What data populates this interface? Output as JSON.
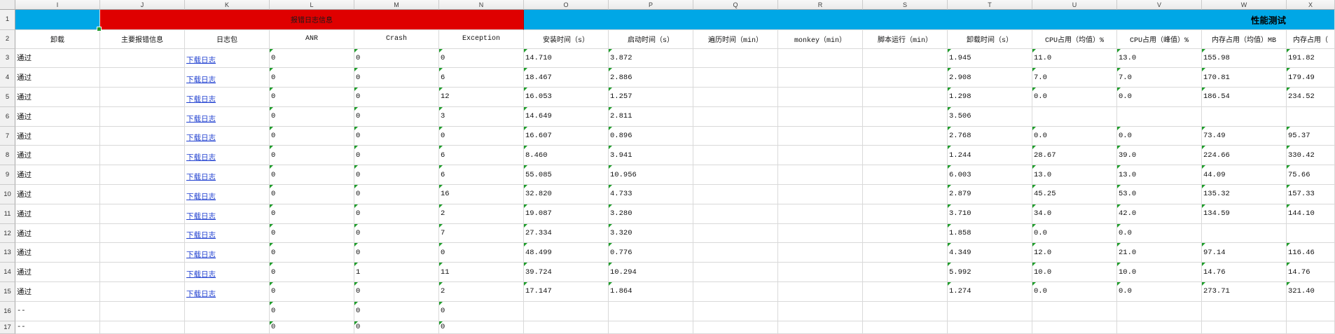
{
  "colors": {
    "error_banner": "#df0000",
    "perf_banner": "#00a7e6",
    "link": "#1f3fd0",
    "indicator": "#1f9d2b"
  },
  "banner": {
    "error_log_title": "报错日志信息",
    "perf_title": "性能测试"
  },
  "columns": [
    "I",
    "J",
    "K",
    "L",
    "M",
    "N",
    "O",
    "P",
    "Q",
    "R",
    "S",
    "T",
    "U",
    "V",
    "W",
    "X"
  ],
  "row_numbers": [
    "1",
    "2",
    "3",
    "4",
    "5",
    "6",
    "7",
    "8",
    "9",
    "10",
    "11",
    "12",
    "13",
    "14",
    "15",
    "16",
    "17"
  ],
  "headers": [
    "卸载",
    "主要报错信息",
    "日志包",
    "ANR",
    "Crash",
    "Exception",
    "安装时间（s）",
    "启动时间（s）",
    "遍历时间（min）",
    "monkey（min）",
    "脚本运行（min）",
    "卸载时间（s）",
    "CPU占用（均值）%",
    "CPU占用（峰值）%",
    "内存占用（均值）MB",
    "内存占用（"
  ],
  "rows": [
    [
      "通过",
      "",
      "下载日志",
      "0",
      "0",
      "0",
      "14.710",
      "3.872",
      "",
      "",
      "",
      "1.945",
      "11.0",
      "13.0",
      "155.98",
      "191.82"
    ],
    [
      "通过",
      "",
      "下载日志",
      "0",
      "0",
      "6",
      "18.467",
      "2.886",
      "",
      "",
      "",
      "2.908",
      "7.0",
      "7.0",
      "170.81",
      "179.49"
    ],
    [
      "通过",
      "",
      "下载日志",
      "0",
      "0",
      "12",
      "16.053",
      "1.257",
      "",
      "",
      "",
      "1.298",
      "0.0",
      "0.0",
      "186.54",
      "234.52"
    ],
    [
      "通过",
      "",
      "下载日志",
      "0",
      "0",
      "3",
      "14.649",
      "2.811",
      "",
      "",
      "",
      "3.506",
      "",
      "",
      "",
      ""
    ],
    [
      "通过",
      "",
      "下载日志",
      "0",
      "0",
      "0",
      "16.607",
      "0.896",
      "",
      "",
      "",
      "2.768",
      "0.0",
      "0.0",
      "73.49",
      "95.37"
    ],
    [
      "通过",
      "",
      "下载日志",
      "0",
      "0",
      "6",
      "8.460",
      "3.941",
      "",
      "",
      "",
      "1.244",
      "28.67",
      "39.0",
      "224.66",
      "330.42"
    ],
    [
      "通过",
      "",
      "下载日志",
      "0",
      "0",
      "6",
      "55.085",
      "10.956",
      "",
      "",
      "",
      "6.003",
      "13.0",
      "13.0",
      "44.09",
      "75.66"
    ],
    [
      "通过",
      "",
      "下载日志",
      "0",
      "0",
      "16",
      "32.820",
      "4.733",
      "",
      "",
      "",
      "2.879",
      "45.25",
      "53.0",
      "135.32",
      "157.33"
    ],
    [
      "通过",
      "",
      "下载日志",
      "0",
      "0",
      "2",
      "19.087",
      "3.280",
      "",
      "",
      "",
      "3.710",
      "34.0",
      "42.0",
      "134.59",
      "144.10"
    ],
    [
      "通过",
      "",
      "下载日志",
      "0",
      "0",
      "7",
      "27.334",
      "3.320",
      "",
      "",
      "",
      "1.858",
      "0.0",
      "0.0",
      "",
      ""
    ],
    [
      "通过",
      "",
      "下载日志",
      "0",
      "0",
      "0",
      "48.499",
      "0.776",
      "",
      "",
      "",
      "4.349",
      "12.0",
      "21.0",
      "97.14",
      "116.46"
    ],
    [
      "通过",
      "",
      "下载日志",
      "0",
      "1",
      "11",
      "39.724",
      "10.294",
      "",
      "",
      "",
      "5.992",
      "10.0",
      "10.0",
      "14.76",
      "14.76"
    ],
    [
      "通过",
      "",
      "下载日志",
      "0",
      "0",
      "2",
      "17.147",
      "1.864",
      "",
      "",
      "",
      "1.274",
      "0.0",
      "0.0",
      "273.71",
      "321.40"
    ],
    [
      "--",
      "",
      "",
      "0",
      "0",
      "0",
      "",
      "",
      "",
      "",
      "",
      "",
      "",
      "",
      "",
      ""
    ],
    [
      "--",
      "",
      "",
      "0",
      "0",
      "0",
      "",
      "",
      "",
      "",
      "",
      "",
      "",
      "",
      "",
      ""
    ]
  ]
}
